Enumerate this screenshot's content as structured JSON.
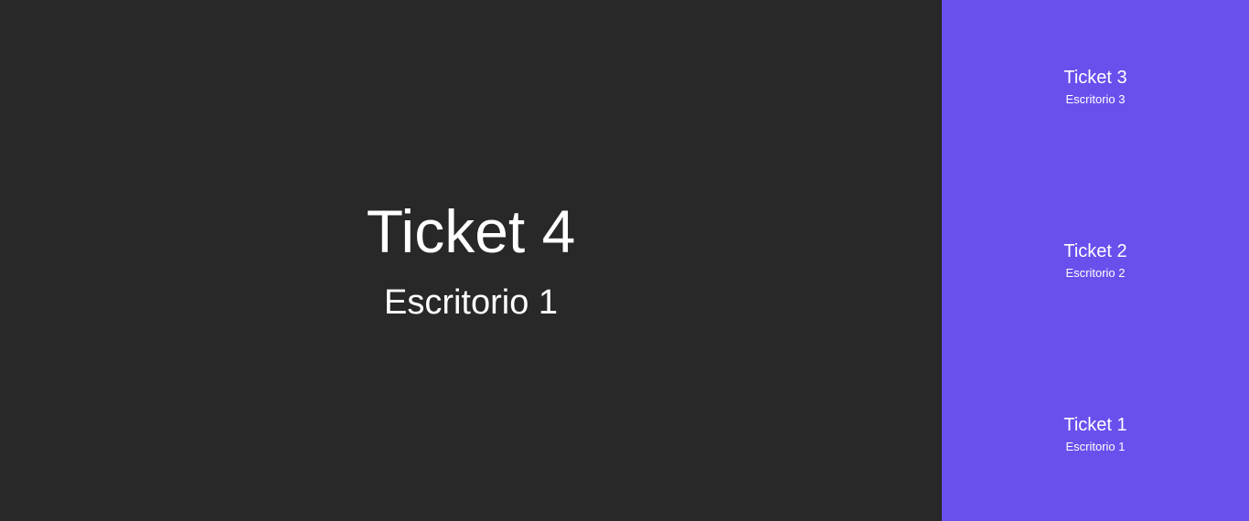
{
  "current": {
    "ticket": "Ticket 4",
    "desk": "Escritorio 1"
  },
  "queue": [
    {
      "ticket": "Ticket 3",
      "desk": "Escritorio 3"
    },
    {
      "ticket": "Ticket 2",
      "desk": "Escritorio 2"
    },
    {
      "ticket": "Ticket 1",
      "desk": "Escritorio 1"
    }
  ],
  "colors": {
    "main_background": "#282828",
    "side_background": "#6950ed",
    "text": "#ffffff"
  }
}
